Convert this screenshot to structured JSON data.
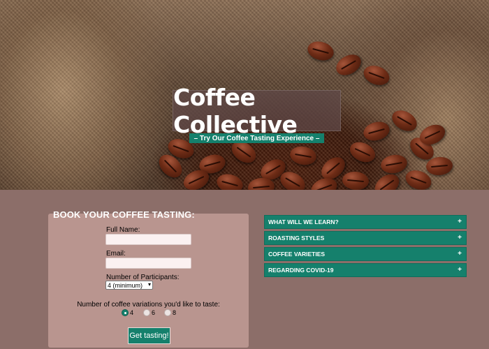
{
  "hero": {
    "title": "Coffee Collective",
    "tagline": "– Try Our Coffee Tasting Experience –"
  },
  "booking": {
    "heading": "BOOK YOUR COFFEE TASTING:",
    "full_name_label": "Full Name:",
    "full_name_value": "",
    "email_label": "Email:",
    "email_value": "",
    "participants_label": "Number of Participants:",
    "participants_selected": "4 (minimum)",
    "variations_label": "Number of coffee variations you'd like to taste:",
    "variation_options": [
      "4",
      "6",
      "8"
    ],
    "variation_selected": "4",
    "submit_label": "Get tasting!"
  },
  "accordion": {
    "items": [
      {
        "label": "WHAT WILL WE LEARN?",
        "toggle": "+"
      },
      {
        "label": "ROASTING STYLES",
        "toggle": "+"
      },
      {
        "label": "COFFEE VARIETIES",
        "toggle": "+"
      },
      {
        "label": "REGARDING COVID-19",
        "toggle": "+"
      }
    ]
  },
  "colors": {
    "page_background": "#8c6e69",
    "form_card": "#b9958f",
    "accent_teal": "#15806c",
    "title_box": "#5f4846"
  }
}
